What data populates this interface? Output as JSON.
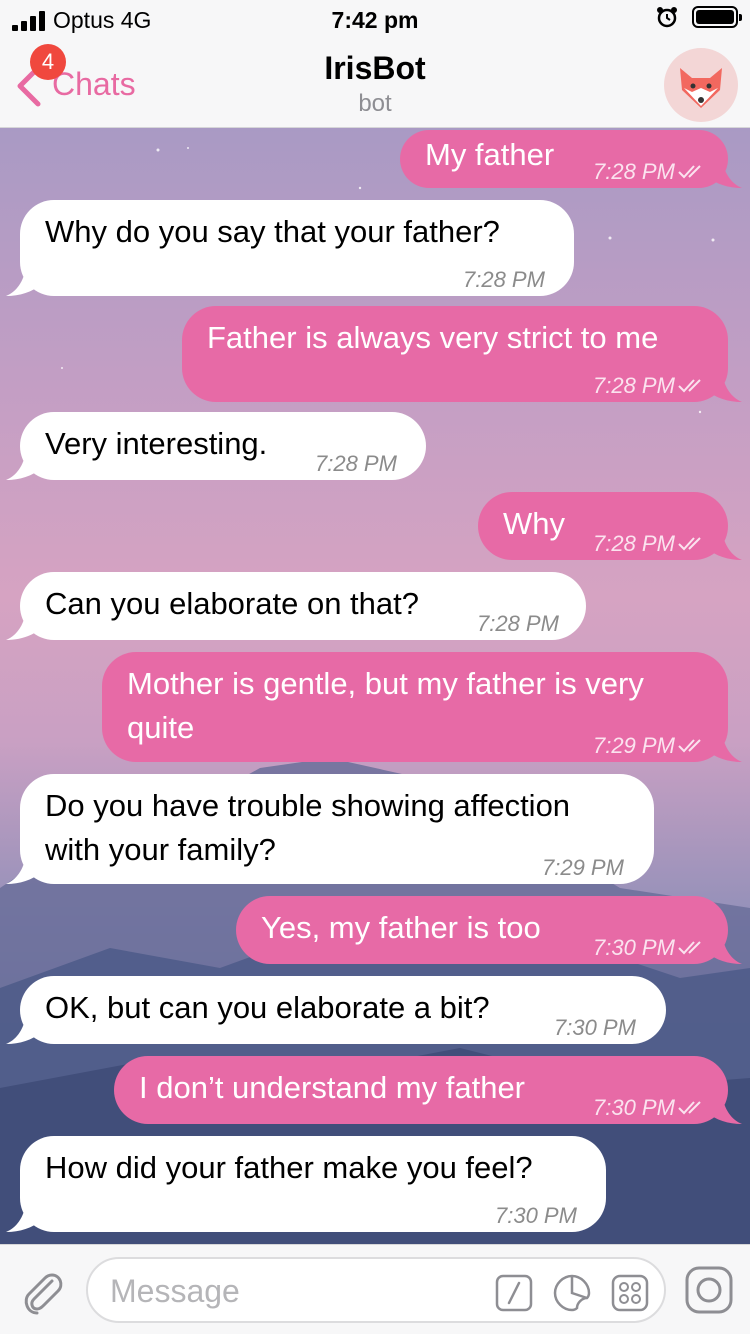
{
  "status_bar": {
    "carrier": "Optus 4G",
    "time": "7:42 pm"
  },
  "nav": {
    "back_label": "Chats",
    "unread_badge": "4",
    "title": "IrisBot",
    "subtitle": "bot"
  },
  "messages": [
    {
      "dir": "out",
      "text": "My father",
      "time": "7:28 PM"
    },
    {
      "dir": "in",
      "text": "Why do you say that your father?",
      "time": "7:28 PM"
    },
    {
      "dir": "out",
      "text": "Father is always very strict to me",
      "time": "7:28 PM"
    },
    {
      "dir": "in",
      "text": "Very interesting.",
      "time": "7:28 PM"
    },
    {
      "dir": "out",
      "text": "Why",
      "time": "7:28 PM"
    },
    {
      "dir": "in",
      "text": "Can you elaborate on that?",
      "time": "7:28 PM"
    },
    {
      "dir": "out",
      "text_line1": "Mother is gentle, but my father is very",
      "text_line2": "quite",
      "time": "7:29 PM"
    },
    {
      "dir": "in",
      "text_line1": "Do you have trouble showing affection",
      "text_line2": "with your family?",
      "time": "7:29 PM"
    },
    {
      "dir": "out",
      "text": "Yes, my father is too",
      "time": "7:30 PM"
    },
    {
      "dir": "in",
      "text": "OK, but can you elaborate a bit?",
      "time": "7:30 PM"
    },
    {
      "dir": "out",
      "text": "I don’t understand my father",
      "time": "7:30 PM"
    },
    {
      "dir": "in",
      "text": "How did your father make you feel?",
      "time": "7:30 PM"
    }
  ],
  "input": {
    "placeholder": "Message"
  },
  "colors": {
    "outgoing_bubble": "#e76aa6",
    "incoming_bubble": "#ffffff",
    "accent": "#e86aa2",
    "badge": "#f0483e"
  },
  "icons": [
    "signal-icon",
    "alarm-icon",
    "battery-icon",
    "back-chevron-icon",
    "fox-avatar-icon",
    "read-ticks-icon",
    "attach-icon",
    "command-icon",
    "sticker-icon",
    "bot-keyboard-icon",
    "camera-icon"
  ]
}
